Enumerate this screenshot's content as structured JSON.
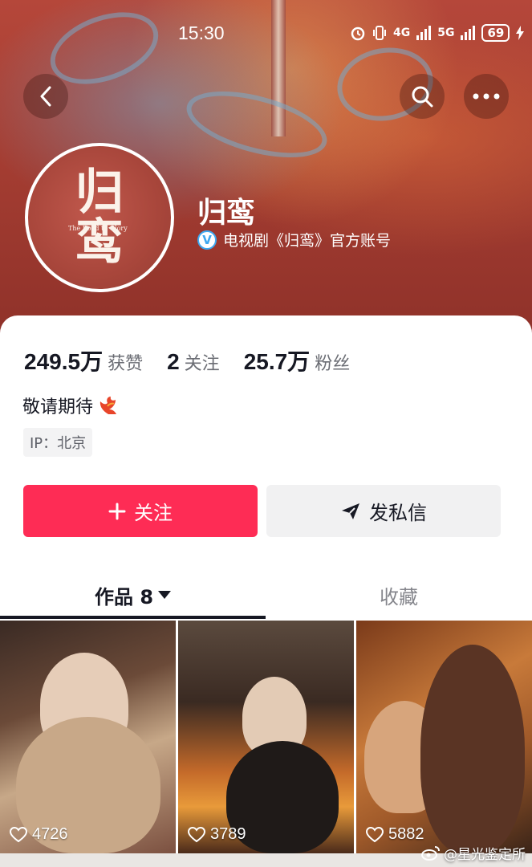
{
  "status_bar": {
    "time": "15:30",
    "network_a": "4G",
    "network_b": "5G",
    "battery": "69"
  },
  "profile": {
    "name": "归鸾",
    "verified_text": "电视剧《归鸾》官方账号",
    "avatar_text": "归鸾",
    "avatar_subtext": "The Road to Glory",
    "bio": "敬请期待",
    "ip": "IP：北京"
  },
  "stats": {
    "likes_value": "249.5万",
    "likes_label": "获赞",
    "following_value": "2",
    "following_label": "关注",
    "followers_value": "25.7万",
    "followers_label": "粉丝"
  },
  "actions": {
    "follow_label": "关注",
    "message_label": "发私信"
  },
  "tabs": {
    "works_label": "作品 8",
    "favorites_label": "收藏"
  },
  "videos": [
    {
      "likes": "4726"
    },
    {
      "likes": "3789"
    },
    {
      "likes": "5882"
    }
  ],
  "watermark": "@星光鉴定所",
  "colors": {
    "accent": "#fe2c55",
    "banner": "#a53d32",
    "verified": "#3ea8f0"
  }
}
